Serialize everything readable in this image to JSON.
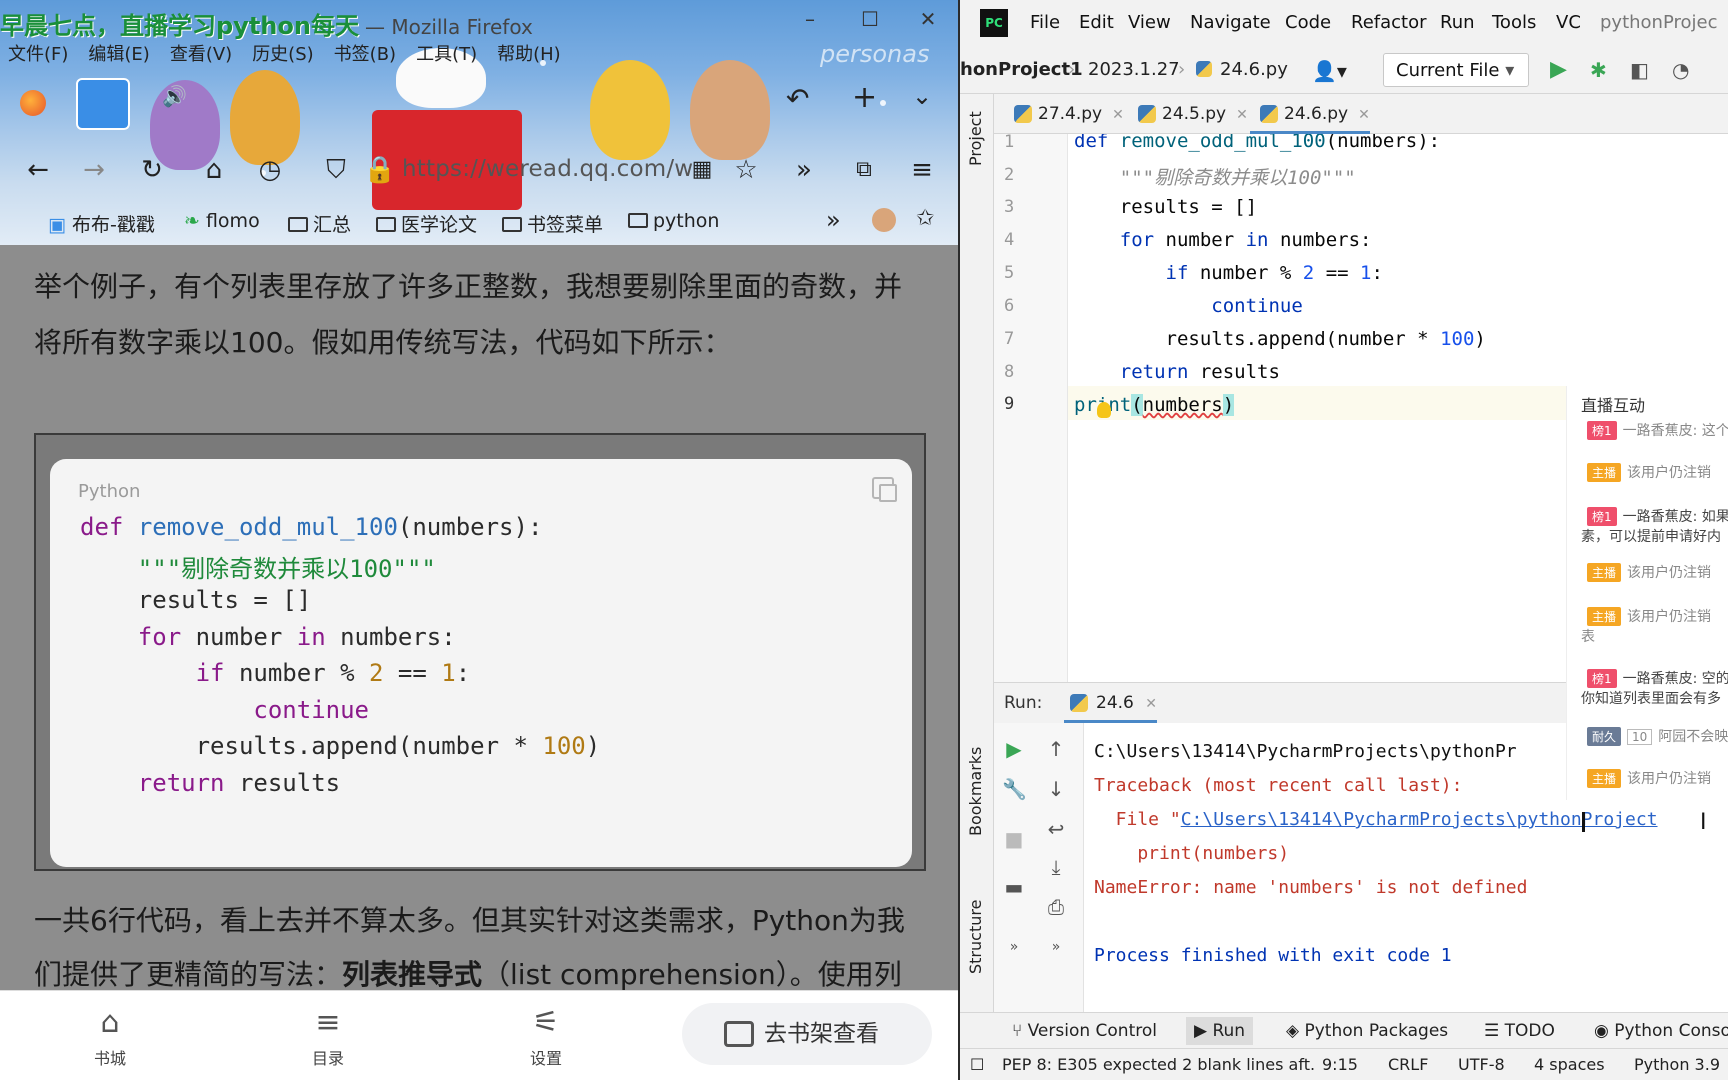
{
  "overlay_title": "早晨七点，直播学习python每天",
  "firefox": {
    "window_title_rest": "— Mozilla Firefox",
    "menu": [
      "文件(F)",
      "编辑(E)",
      "查看(V)",
      "历史(S)",
      "书签(B)",
      "工具(T)",
      "帮助(H)"
    ],
    "url": "https://weread.qq.com/w",
    "bookmarks": [
      "布布-戳戳",
      "flomo",
      "汇总",
      "医学论文",
      "书签菜单",
      "python"
    ],
    "theme_watermark": "personas",
    "paragraph1_line1": "举个例子，有个列表里存放了许多正整数，我想要剔除里面的奇数，并",
    "paragraph1_line2": "将所有数字乘以100。假如用传统写法，代码如下所示：",
    "code_lang": "Python",
    "paragraph2_line1": "一共6行代码，看上去并不算太多。但其实针对这类需求，Python为我",
    "paragraph2_line2_a": "们提供了更精简的写法：",
    "paragraph2_line2_b": "列表推导式",
    "paragraph2_line2_c": "（list comprehension）。使用列",
    "bottom_nav": [
      "书城",
      "目录",
      "设置"
    ],
    "shelf_button": "去书架查看"
  },
  "pycharm": {
    "menu": [
      "File",
      "Edit",
      "View",
      "Navigate",
      "Code",
      "Refactor",
      "Run",
      "Tools",
      "VC",
      "pythonProjec"
    ],
    "breadcrumbs": [
      "honProject1",
      "2023.1.27",
      "24.6.py"
    ],
    "run_config": "Current File",
    "left_strip": [
      "Project",
      "Bookmarks",
      "Structure"
    ],
    "tabs": [
      "27.4.py",
      "24.5.py",
      "24.6.py"
    ],
    "line_numbers": [
      "1",
      "2",
      "3",
      "4",
      "5",
      "6",
      "7",
      "8",
      "9"
    ],
    "code": {
      "l1_kw": "def",
      "l1_fn": "remove_odd_mul_100",
      "l1_rest": "(numbers):",
      "l2_doc": "\"\"\"剔除奇数并乘以100\"\"\"",
      "l3": "results = []",
      "l4_kw": "for",
      "l4_a": " number ",
      "l4_in": "in",
      "l4_b": " numbers:",
      "l5_kw": "if",
      "l5_a": " number % ",
      "l5_n1": "2",
      "l5_b": " == ",
      "l5_n2": "1",
      "l5_c": ":",
      "l6_kw": "continue",
      "l7_a": "results.append(number * ",
      "l7_n": "100",
      "l7_b": ")",
      "l8_kw": "return",
      "l8_a": " results",
      "l9_fn": "print",
      "l9_p1": "(",
      "l9_arg": "numbers",
      "l9_p2": ")"
    },
    "live_panel": {
      "title": "直播互动",
      "msgs": [
        {
          "badge": "榜1",
          "text": "一路香蕉皮: 这个"
        },
        {
          "badge": "主播",
          "text": "该用户仍注销"
        },
        {
          "badge": "榜1",
          "text": "一路香蕉皮: 如果"
        },
        {
          "badge": "",
          "text": "素，可以提前申请好内"
        },
        {
          "badge": "主播",
          "text": "该用户仍注销"
        },
        {
          "badge": "主播",
          "text": "该用户仍注销"
        },
        {
          "badge": "",
          "text": "表"
        },
        {
          "badge": "榜1",
          "text": "一路香蕉皮: 空的"
        },
        {
          "badge": "",
          "text": "你知道列表里面会有多"
        },
        {
          "badge": "耐久",
          "text": "阿园不会映"
        },
        {
          "badge": "主播",
          "text": "该用户仍注销"
        }
      ],
      "badge_num": "10"
    },
    "run": {
      "label": "Run:",
      "tab": "24.6",
      "out1": "C:\\Users\\13414\\PycharmProjects\\pythonPr",
      "out2": "Traceback (most recent call last):",
      "out3_a": "  File \"",
      "out3_link": "C:\\Users\\13414\\PycharmProjects\\pythonProject",
      "out4": "    print(numbers)",
      "out5": "NameError: name 'numbers' is not defined",
      "out6": "Process finished with exit code 1"
    },
    "toolwindows": [
      "Version Control",
      "Run",
      "Python Packages",
      "TODO",
      "Python Conso"
    ],
    "status": {
      "msg": "PEP 8: E305 expected 2 blank lines aft.",
      "pos": "9:15",
      "eol": "CRLF",
      "enc": "UTF-8",
      "indent": "4 spaces",
      "interp": "Python 3.9"
    }
  }
}
